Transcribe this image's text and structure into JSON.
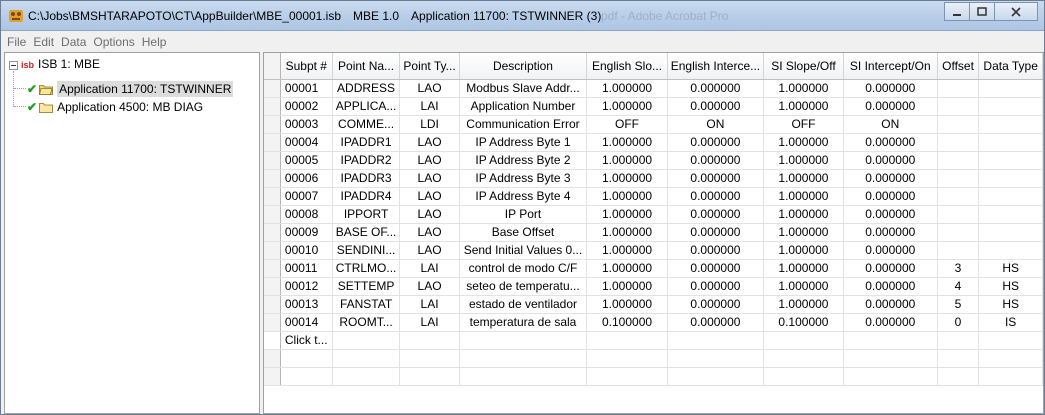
{
  "window": {
    "title_path": "C:\\Jobs\\BMSHTARAPOTO\\CT\\AppBuilder\\MBE_00001.isb",
    "title_version": "MBE 1.0",
    "title_app": "Application 11700: TSTWINNER  (3)",
    "title_background_ghost": "pdf - Adobe Acrobat Pro"
  },
  "menu": [
    "File",
    "Edit",
    "Data",
    "Options",
    "Help"
  ],
  "tree": {
    "root": "ISB 1: MBE",
    "children": [
      {
        "label": "Application 11700: TSTWINNER",
        "selected": true
      },
      {
        "label": "Application 4500: MB DIAG",
        "selected": false
      }
    ]
  },
  "grid": {
    "columns": [
      "Subpt #",
      "Point Na...",
      "Point Ty...",
      "Description",
      "English Slo...",
      "English Interce...",
      "SI Slope/Off",
      "SI Intercept/On",
      "Offset",
      "Data Type"
    ],
    "rows": [
      [
        "00001",
        "ADDRESS",
        "LAO",
        "Modbus Slave Addr...",
        "1.000000",
        "0.000000",
        "1.000000",
        "0.000000",
        "",
        ""
      ],
      [
        "00002",
        "APPLICA...",
        "LAI",
        "Application Number",
        "1.000000",
        "0.000000",
        "1.000000",
        "0.000000",
        "",
        ""
      ],
      [
        "00003",
        "COMME...",
        "LDI",
        "Communication Error",
        "OFF",
        "ON",
        "OFF",
        "ON",
        "",
        ""
      ],
      [
        "00004",
        "IPADDR1",
        "LAO",
        "IP Address Byte 1",
        "1.000000",
        "0.000000",
        "1.000000",
        "0.000000",
        "",
        ""
      ],
      [
        "00005",
        "IPADDR2",
        "LAO",
        "IP Address Byte 2",
        "1.000000",
        "0.000000",
        "1.000000",
        "0.000000",
        "",
        ""
      ],
      [
        "00006",
        "IPADDR3",
        "LAO",
        "IP Address Byte 3",
        "1.000000",
        "0.000000",
        "1.000000",
        "0.000000",
        "",
        ""
      ],
      [
        "00007",
        "IPADDR4",
        "LAO",
        "IP Address Byte 4",
        "1.000000",
        "0.000000",
        "1.000000",
        "0.000000",
        "",
        ""
      ],
      [
        "00008",
        "IPPORT",
        "LAO",
        "IP Port",
        "1.000000",
        "0.000000",
        "1.000000",
        "0.000000",
        "",
        ""
      ],
      [
        "00009",
        "BASE OF...",
        "LAO",
        "Base Offset",
        "1.000000",
        "0.000000",
        "1.000000",
        "0.000000",
        "",
        ""
      ],
      [
        "00010",
        "SENDINI...",
        "LAO",
        "Send Initial Values 0...",
        "1.000000",
        "0.000000",
        "1.000000",
        "0.000000",
        "",
        ""
      ],
      [
        "00011",
        "CTRLMO...",
        "LAI",
        "control de modo C/F",
        "1.000000",
        "0.000000",
        "1.000000",
        "0.000000",
        "3",
        "HS"
      ],
      [
        "00012",
        "SETTEMP",
        "LAO",
        "seteo de temperatu...",
        "1.000000",
        "0.000000",
        "1.000000",
        "0.000000",
        "4",
        "HS"
      ],
      [
        "00013",
        "FANSTAT",
        "LAI",
        "estado de ventilador",
        "1.000000",
        "0.000000",
        "1.000000",
        "0.000000",
        "5",
        "HS"
      ],
      [
        "00014",
        "ROOMT...",
        "LAI",
        "temperatura de sala",
        "0.100000",
        "0.000000",
        "0.100000",
        "0.000000",
        "0",
        "IS"
      ]
    ],
    "new_row_text": "Click t..."
  }
}
